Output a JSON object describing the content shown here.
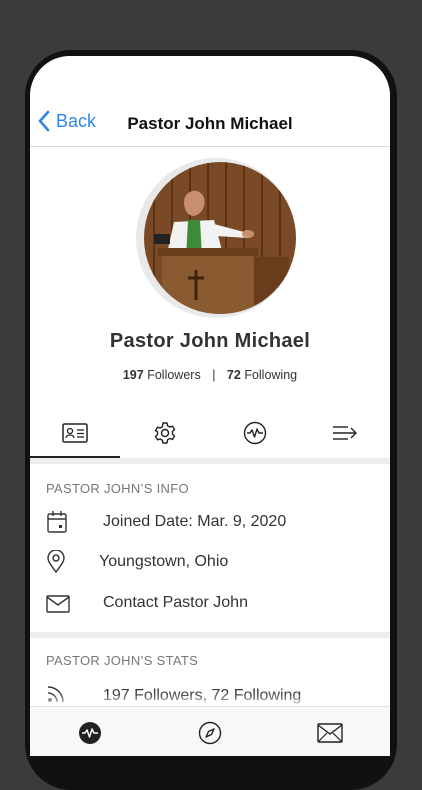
{
  "nav": {
    "back_label": "Back",
    "title": "Pastor John Michael"
  },
  "profile": {
    "name": "Pastor John Michael",
    "followers_count": "197",
    "followers_label": "Followers",
    "separator": "|",
    "following_count": "72",
    "following_label": "Following"
  },
  "tabs": [
    {
      "icon": "contact-card-icon",
      "active": true
    },
    {
      "icon": "gear-icon",
      "active": false
    },
    {
      "icon": "activity-icon",
      "active": false
    },
    {
      "icon": "list-arrow-icon",
      "active": false
    }
  ],
  "info": {
    "header": "PASTOR JOHN’S INFO",
    "joined": "Joined Date: Mar. 9, 2020",
    "location": "Youngstown, Ohio",
    "contact": "Contact Pastor John"
  },
  "stats": {
    "header": "PASTOR JOHN’S STATS",
    "followers_summary": "197 Followers, 72 Following"
  },
  "bottom_tabs": [
    {
      "icon": "activity-icon"
    },
    {
      "icon": "compass-icon"
    },
    {
      "icon": "mail-icon"
    }
  ],
  "colors": {
    "accent": "#2f86e6",
    "background": "#3b3b3b",
    "screen": "#ffffff"
  }
}
